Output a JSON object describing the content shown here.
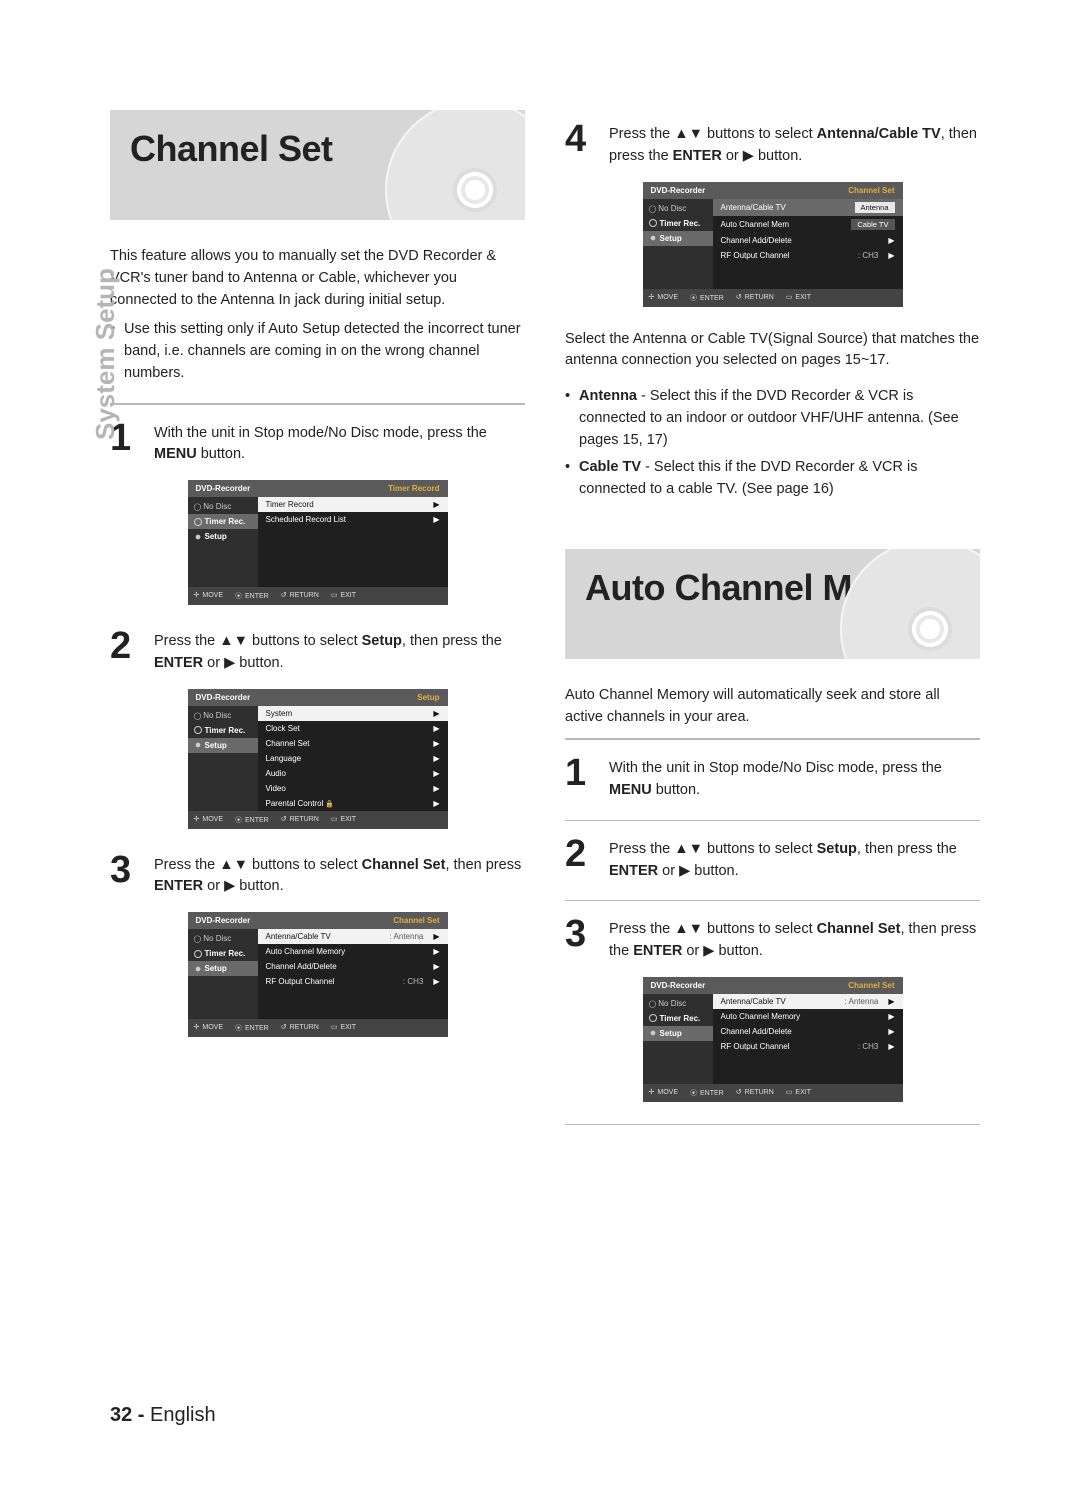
{
  "sideTab": "System Setup",
  "pageFooter": {
    "num": "32 -",
    "lang": "English"
  },
  "left": {
    "header": "Channel Set",
    "intro": "This feature allows you to manually set the DVD Recorder & VCR's tuner band to Antenna or Cable, whichever you connected to the Antenna In jack during initial setup.",
    "bullet1": "Use this setting only if Auto Setup detected the incorrect tuner band, i.e. channels are coming in on the wrong channel numbers.",
    "step1_a": "With the unit in Stop mode/No Disc mode, press the ",
    "step1_b": "MENU",
    "step1_c": " button.",
    "step2_a": "Press the ▲▼ buttons to select ",
    "step2_b": "Setup",
    "step2_c": ", then press the ",
    "step2_d": "ENTER",
    "step2_e": " or ▶ button.",
    "step3_a": "Press the ▲▼ buttons to select ",
    "step3_b": "Channel Set",
    "step3_c": ", then press ",
    "step3_d": "ENTER",
    "step3_e": " or ▶ button."
  },
  "right": {
    "step4_a": "Press the ▲▼ buttons to select ",
    "step4_b": "Antenna/Cable TV",
    "step4_c": ", then press the ",
    "step4_d": "ENTER",
    "step4_e": " or ▶ button.",
    "afterOsd": "Select the Antenna or Cable TV(Signal Source) that matches the antenna connection you selected on pages 15~17.",
    "antenna_b": "Antenna",
    "antenna_t": " - Select this if the DVD Recorder & VCR is connected to an indoor or outdoor VHF/UHF antenna. (See pages 15, 17)",
    "cable_b": "Cable TV",
    "cable_t": " - Select this if the DVD Recorder & VCR is connected to a cable TV. (See page 16)",
    "header2": "Auto Channel Memory",
    "intro2": "Auto Channel Memory will automatically seek and store all active channels in your area.",
    "s1_a": "With the unit in Stop mode/No Disc mode, press the ",
    "s1_b": "MENU",
    "s1_c": " button.",
    "s2_a": "Press the ▲▼ buttons to select ",
    "s2_b": "Setup",
    "s2_c": ", then press the ",
    "s2_d": "ENTER",
    "s2_e": " or ▶ button.",
    "s3_a": "Press the ▲▼ buttons to select ",
    "s3_b": "Channel Set",
    "s3_c": ", then press the ",
    "s3_d": "ENTER",
    "s3_e": " or ▶ button."
  },
  "osd": {
    "brand": "DVD-Recorder",
    "noDisc": "No Disc",
    "timerRec": "Timer Rec.",
    "setup": "Setup",
    "foot": {
      "move": "MOVE",
      "enter": "ENTER",
      "return": "RETURN",
      "exit": "EXIT"
    },
    "crumb_timer": "Timer Record",
    "crumb_setup": "Setup",
    "crumb_chan": "Channel Set",
    "m1": {
      "r1": "Timer Record",
      "r2": "Scheduled Record List"
    },
    "m2": {
      "r1": "System",
      "r2": "Clock Set",
      "r3": "Channel Set",
      "r4": "Language",
      "r5": "Audio",
      "r6": "Video",
      "r7": "Parental Control"
    },
    "m3": {
      "r1": "Antenna/Cable TV",
      "r1v": ": Antenna",
      "r2": "Auto Channel Memory",
      "r3": "Channel Add/Delete",
      "r4": "RF Output Channel",
      "r4v": ": CH3"
    },
    "m4": {
      "r1": "Antenna/Cable TV",
      "opt1": "Antenna",
      "r2": "Auto Channel Mem",
      "opt2": "Cable TV",
      "r3": "Channel Add/Delete",
      "r4": "RF Output Channel",
      "r4v": ": CH3"
    }
  }
}
